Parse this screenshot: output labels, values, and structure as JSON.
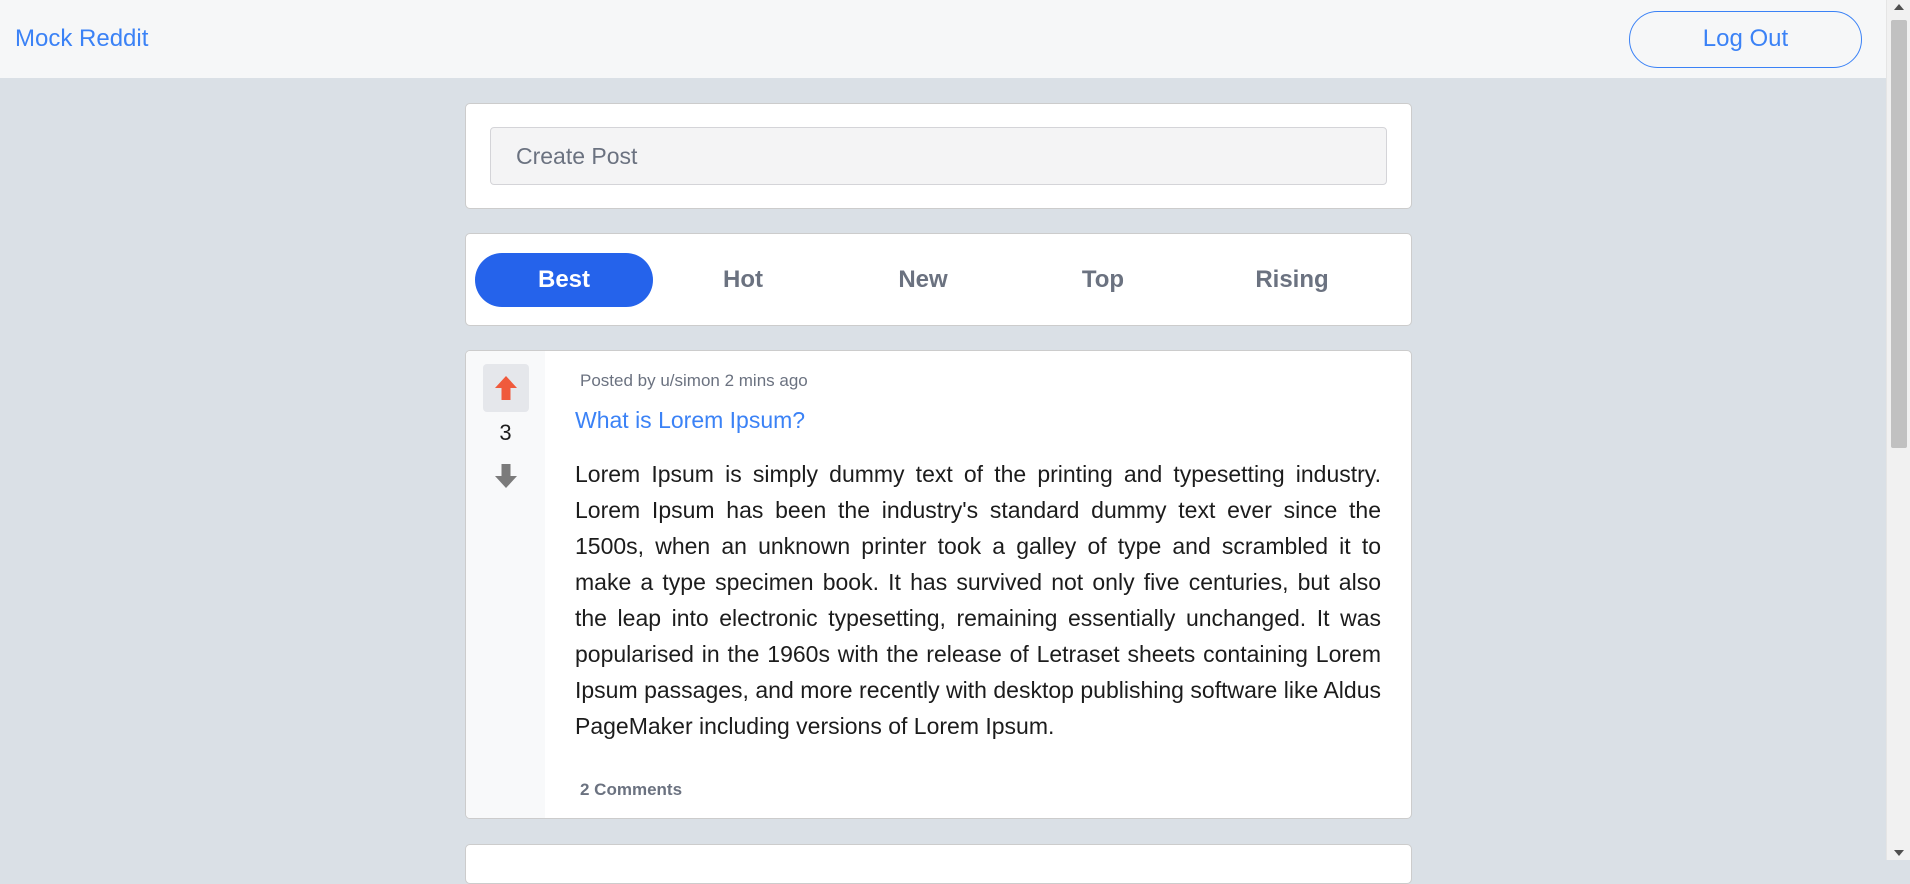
{
  "header": {
    "brand": "Mock Reddit",
    "logout_label": "Log Out"
  },
  "create_post": {
    "placeholder": "Create Post"
  },
  "sort_tabs": [
    {
      "label": "Best",
      "active": true
    },
    {
      "label": "Hot",
      "active": false
    },
    {
      "label": "New",
      "active": false
    },
    {
      "label": "Top",
      "active": false
    },
    {
      "label": "Rising",
      "active": false
    }
  ],
  "posts": [
    {
      "meta": "Posted by u/simon 2 mins ago",
      "title": "What is Lorem Ipsum?",
      "body": "Lorem Ipsum is simply dummy text of the printing and typesetting industry. Lorem Ipsum has been the industry's standard dummy text ever since the 1500s, when an unknown printer took a galley of type and scrambled it to make a type specimen book. It has survived not only five centuries, but also the leap into electronic typesetting, remaining essentially unchanged. It was popularised in the 1960s with the release of Letraset sheets containing Lorem Ipsum passages, and more recently with desktop publishing software like Aldus PageMaker including versions of Lorem Ipsum.",
      "votes": "3",
      "comments": "2 Comments",
      "upvoted": true
    }
  ],
  "colors": {
    "accent": "#3b82f6",
    "active_tab": "#2563eb",
    "upvote": "#f05a3c",
    "downvote": "#7b7b7b"
  }
}
